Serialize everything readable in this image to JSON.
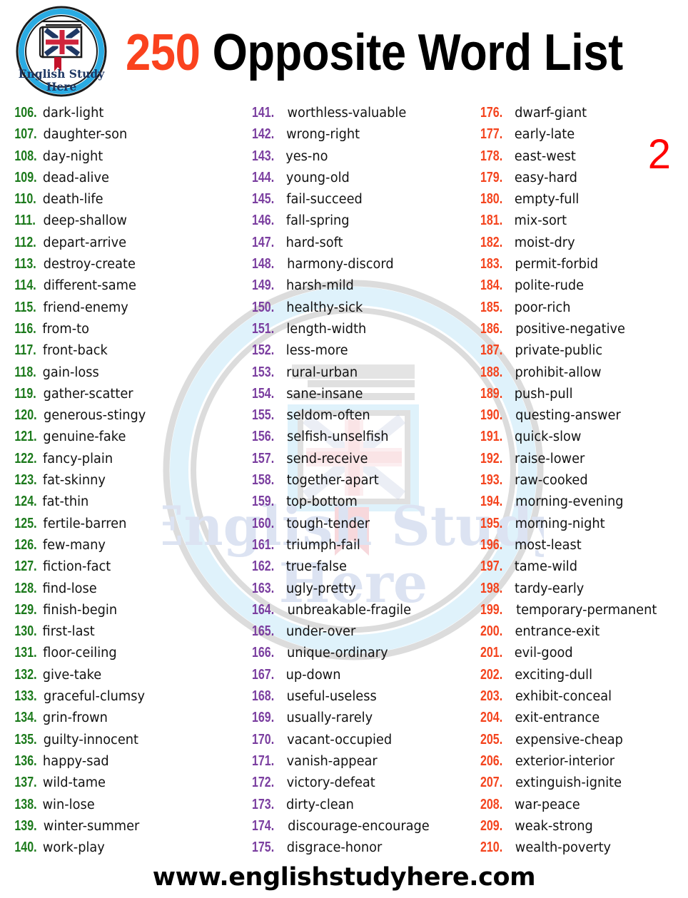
{
  "header": {
    "count": "250",
    "title": " Opposite Word List",
    "full_title": "250 Opposite Word List",
    "logo": {
      "line1": "English Study",
      "line2": "Here",
      "ring_color": "#29ABE2",
      "text_color": "#1F3864"
    }
  },
  "page_number": "2",
  "colors": {
    "count_accent": "#FA421E",
    "column1_number": "#1C7A1C",
    "column2_number": "#7B3FA0",
    "column3_number": "#F4441E",
    "page_number": "#FF0000",
    "word_text": "#111111"
  },
  "watermark": {
    "line1": "English Study",
    "line2": "Here",
    "tint": "#DCE6F5"
  },
  "columns": [
    {
      "id": "column-1",
      "number_color": "#1C7A1C",
      "rows": [
        {
          "num": "106.",
          "word": "dark-light"
        },
        {
          "num": "107.",
          "word": "daughter-son"
        },
        {
          "num": "108.",
          "word": "day-night"
        },
        {
          "num": "109.",
          "word": "dead-alive"
        },
        {
          "num": "110.",
          "word": "death-life"
        },
        {
          "num": "111.",
          "word": "deep-shallow"
        },
        {
          "num": "112.",
          "word": "depart-arrive"
        },
        {
          "num": "113.",
          "word": "destroy-create"
        },
        {
          "num": "114.",
          "word": "different-same"
        },
        {
          "num": "115.",
          "word": "friend-enemy"
        },
        {
          "num": "116.",
          "word": "from-to"
        },
        {
          "num": "117.",
          "word": "front-back"
        },
        {
          "num": "118.",
          "word": "gain-loss"
        },
        {
          "num": "119.",
          "word": "gather-scatter"
        },
        {
          "num": "120.",
          "word": "generous-stingy"
        },
        {
          "num": "121.",
          "word": "genuine-fake"
        },
        {
          "num": "122.",
          "word": "fancy-plain"
        },
        {
          "num": "123.",
          "word": "fat-skinny"
        },
        {
          "num": "124.",
          "word": "fat-thin"
        },
        {
          "num": "125.",
          "word": "fertile-barren"
        },
        {
          "num": "126.",
          "word": "few-many"
        },
        {
          "num": "127.",
          "word": "fiction-fact"
        },
        {
          "num": "128.",
          "word": "find-lose"
        },
        {
          "num": "129.",
          "word": "finish-begin"
        },
        {
          "num": "130.",
          "word": "first-last"
        },
        {
          "num": "131.",
          "word": "floor-ceiling"
        },
        {
          "num": "132.",
          "word": "give-take"
        },
        {
          "num": "133.",
          "word": "graceful-clumsy"
        },
        {
          "num": "134.",
          "word": "grin-frown"
        },
        {
          "num": "135.",
          "word": "guilty-innocent"
        },
        {
          "num": "136.",
          "word": "happy-sad"
        },
        {
          "num": "137.",
          "word": "wild-tame"
        },
        {
          "num": "138.",
          "word": "win-lose"
        },
        {
          "num": "139.",
          "word": "winter-summer"
        },
        {
          "num": "140.",
          "word": "work-play"
        }
      ]
    },
    {
      "id": "column-2",
      "number_color": "#7B3FA0",
      "rows": [
        {
          "num": "141.",
          "word": "worthless-valuable"
        },
        {
          "num": "142.",
          "word": "wrong-right"
        },
        {
          "num": "143.",
          "word": "yes-no"
        },
        {
          "num": "144.",
          "word": "young-old"
        },
        {
          "num": "145.",
          "word": "fail-succeed"
        },
        {
          "num": "146.",
          "word": "fall-spring"
        },
        {
          "num": "147.",
          "word": "hard-soft"
        },
        {
          "num": "148.",
          "word": "harmony-discord"
        },
        {
          "num": "149.",
          "word": "harsh-mild"
        },
        {
          "num": "150.",
          "word": "healthy-sick"
        },
        {
          "num": "151.",
          "word": "length-width"
        },
        {
          "num": "152.",
          "word": "less-more"
        },
        {
          "num": "153.",
          "word": "rural-urban"
        },
        {
          "num": "154.",
          "word": "sane-insane"
        },
        {
          "num": "155.",
          "word": "seldom-often"
        },
        {
          "num": "156.",
          "word": "selfish-unselfish"
        },
        {
          "num": "157.",
          "word": "send-receive"
        },
        {
          "num": "158.",
          "word": "together-apart"
        },
        {
          "num": "159.",
          "word": "top-bottom"
        },
        {
          "num": "160.",
          "word": "tough-tender"
        },
        {
          "num": "161.",
          "word": "triumph-fail"
        },
        {
          "num": "162.",
          "word": "true-false"
        },
        {
          "num": "163.",
          "word": "ugly-pretty"
        },
        {
          "num": "164.",
          "word": "unbreakable-fragile"
        },
        {
          "num": "165.",
          "word": "under-over"
        },
        {
          "num": "166.",
          "word": "unique-ordinary"
        },
        {
          "num": "167.",
          "word": "up-down"
        },
        {
          "num": "168.",
          "word": "useful-useless"
        },
        {
          "num": "169.",
          "word": "usually-rarely"
        },
        {
          "num": "170.",
          "word": "vacant-occupied"
        },
        {
          "num": "171.",
          "word": "vanish-appear"
        },
        {
          "num": "172.",
          "word": "victory-defeat"
        },
        {
          "num": "173.",
          "word": "dirty-clean"
        },
        {
          "num": "174.",
          "word": "discourage-encourage"
        },
        {
          "num": "175.",
          "word": "disgrace-honor"
        }
      ]
    },
    {
      "id": "column-3",
      "number_color": "#F4441E",
      "rows": [
        {
          "num": "176.",
          "word": "dwarf-giant"
        },
        {
          "num": "177.",
          "word": "early-late"
        },
        {
          "num": "178.",
          "word": "east-west"
        },
        {
          "num": "179.",
          "word": "easy-hard"
        },
        {
          "num": "180.",
          "word": "empty-full"
        },
        {
          "num": "181.",
          "word": "mix-sort"
        },
        {
          "num": "182.",
          "word": "moist-dry"
        },
        {
          "num": "183.",
          "word": "permit-forbid"
        },
        {
          "num": "184.",
          "word": "polite-rude"
        },
        {
          "num": "185.",
          "word": "poor-rich"
        },
        {
          "num": "186.",
          "word": "positive-negative"
        },
        {
          "num": "187.",
          "word": "private-public"
        },
        {
          "num": "188.",
          "word": "prohibit-allow"
        },
        {
          "num": "189.",
          "word": "push-pull"
        },
        {
          "num": "190.",
          "word": "questing-answer"
        },
        {
          "num": "191.",
          "word": "quick-slow"
        },
        {
          "num": "192.",
          "word": "raise-lower"
        },
        {
          "num": "193.",
          "word": "raw-cooked"
        },
        {
          "num": "194.",
          "word": "morning-evening"
        },
        {
          "num": "195.",
          "word": "morning-night"
        },
        {
          "num": "196.",
          "word": "most-least"
        },
        {
          "num": "197.",
          "word": "tame-wild"
        },
        {
          "num": "198.",
          "word": "tardy-early"
        },
        {
          "num": "199.",
          "word": "temporary-permanent"
        },
        {
          "num": "200.",
          "word": "entrance-exit"
        },
        {
          "num": "201.",
          "word": "evil-good"
        },
        {
          "num": "202.",
          "word": "exciting-dull"
        },
        {
          "num": "203.",
          "word": "exhibit-conceal"
        },
        {
          "num": "204.",
          "word": "exit-entrance"
        },
        {
          "num": "205.",
          "word": "expensive-cheap"
        },
        {
          "num": "206.",
          "word": "exterior-interior"
        },
        {
          "num": "207.",
          "word": "extinguish-ignite"
        },
        {
          "num": "208.",
          "word": "war-peace"
        },
        {
          "num": "209.",
          "word": "weak-strong"
        },
        {
          "num": "210.",
          "word": "wealth-poverty"
        }
      ]
    }
  ],
  "footer": {
    "url": "www.englishstudyhere.com"
  }
}
